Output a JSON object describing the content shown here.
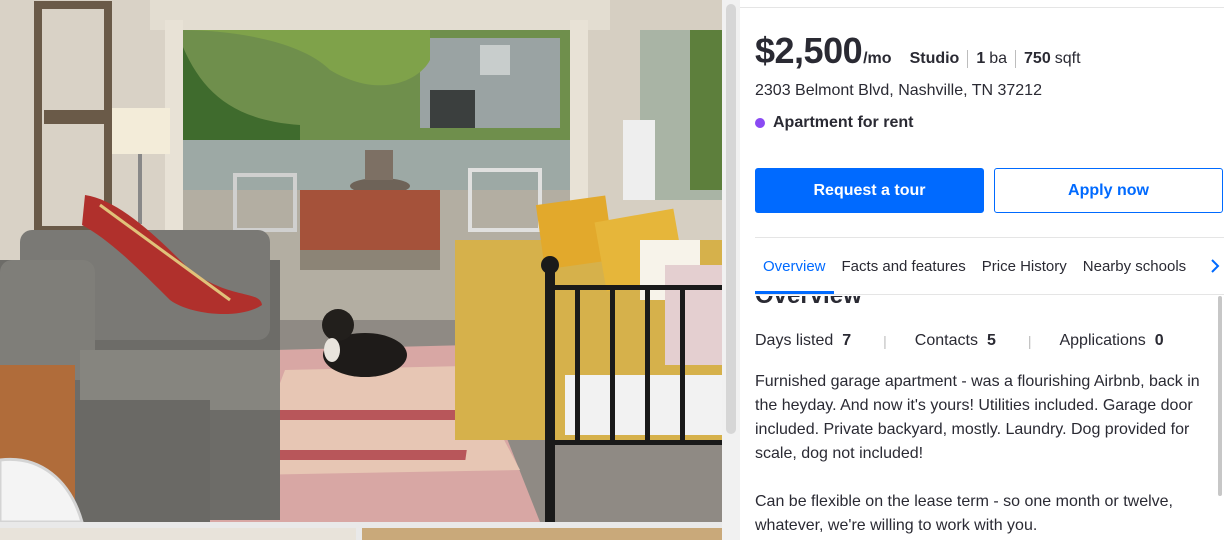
{
  "listing": {
    "price": "$2,500",
    "price_suffix": "/mo",
    "beds": "Studio",
    "baths_value": "1",
    "baths_unit": "ba",
    "area_value": "750",
    "area_unit": "sqft",
    "address": "2303 Belmont Blvd, Nashville, TN 37212",
    "status": "Apartment for rent",
    "status_color": "#8a4af3"
  },
  "actions": {
    "request_tour": "Request a tour",
    "apply_now": "Apply now",
    "primary_color": "#006aff"
  },
  "tabs": [
    {
      "label": "Overview",
      "active": true
    },
    {
      "label": "Facts and features",
      "active": false
    },
    {
      "label": "Price History",
      "active": false
    },
    {
      "label": "Nearby schools",
      "active": false
    }
  ],
  "tabs_next_icon": "chevron-right-icon",
  "overview": {
    "title": "Overview",
    "stats": [
      {
        "label": "Days listed",
        "value": "7"
      },
      {
        "label": "Contacts",
        "value": "5"
      },
      {
        "label": "Applications",
        "value": "0"
      }
    ],
    "stat_separator": "|",
    "description": [
      "Furnished garage apartment - was a flourishing Airbnb, back in the heyday. And now it's yours! Utilities included. Garage door included. Private backyard, mostly. Laundry. Dog provided for scale, dog not included!",
      "Can be flexible on the lease term - so one month or twelve, whatever, we're willing to work with you."
    ]
  },
  "photos": {
    "main_alt_icon": "listing-photo"
  }
}
